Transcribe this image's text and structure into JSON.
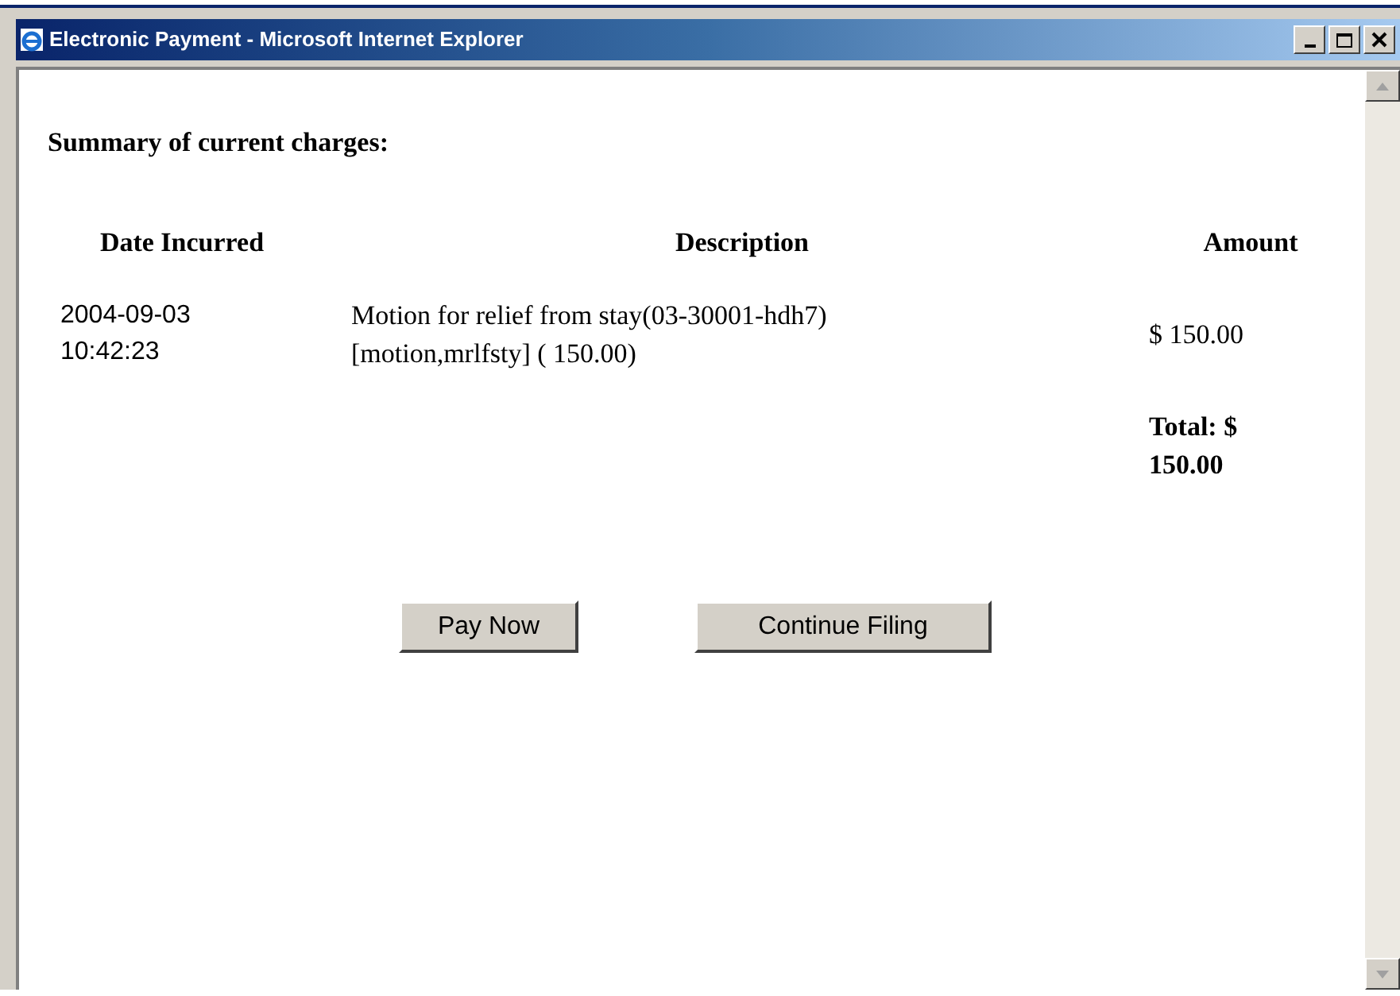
{
  "window": {
    "title": "Electronic Payment - Microsoft Internet Explorer"
  },
  "heading": "Summary of current charges:",
  "table": {
    "columns": [
      "Date Incurred",
      "Description",
      "Amount"
    ],
    "rows": [
      {
        "date": [
          "2004-09-03",
          "10:42:23"
        ],
        "description": "Motion for relief from stay(03-30001-hdh7) [motion,mrlfsty] ( 150.00)",
        "amount": "$ 150.00"
      }
    ],
    "total": "Total: $ 150.00"
  },
  "buttons": [
    "Pay Now",
    "Continue Filing"
  ]
}
